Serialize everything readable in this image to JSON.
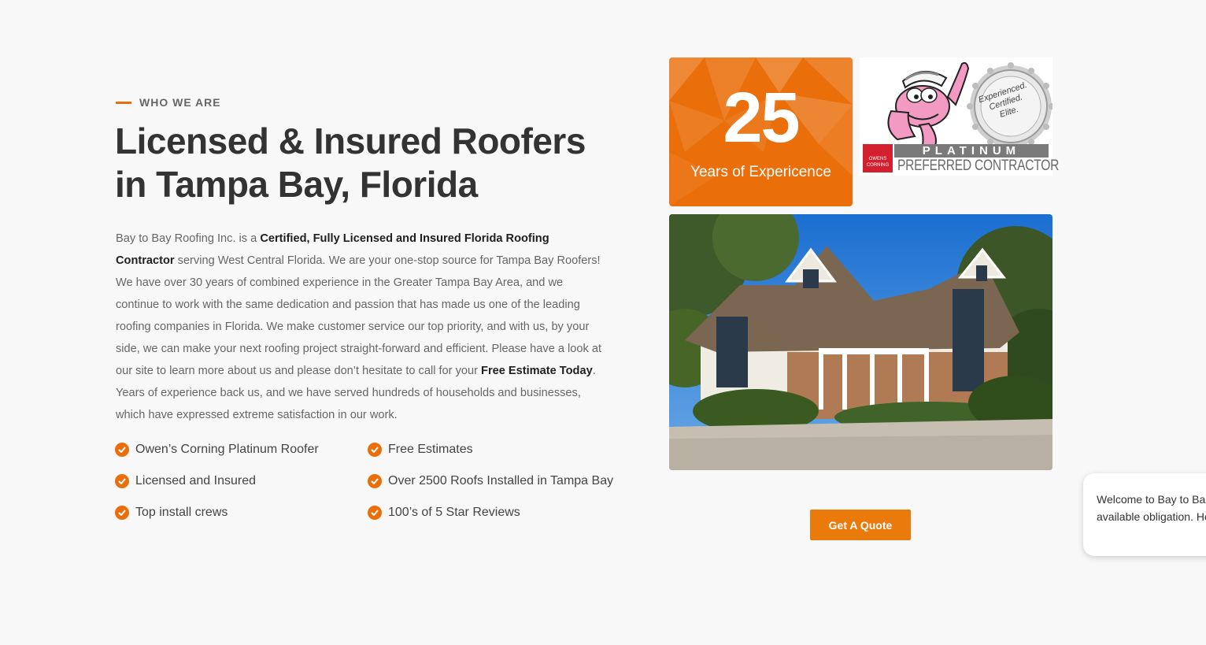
{
  "section": {
    "eyebrow": "WHO WE ARE",
    "heading_line1": "Licensed & Insured Roofers",
    "heading_line2": "in Tampa Bay, Florida"
  },
  "intro": {
    "p1": "Bay to Bay Roofing Inc. is a ",
    "b1": "Certified, Fully Licensed and Insured Florida Roofing Contractor",
    "p2": " serving West Central Florida. We are your one-stop source for Tampa Bay Roofers! We have over 30 years of combined experience in the Greater Tampa Bay Area, and we continue to work with the same dedication and passion that has made us one of the leading roofing companies in Florida. We make customer service our top priority, and with us, by your side, we can make your next roofing project straight-forward and efficient. Please have a look at our site to learn more about us and please don’t hesitate to call for your ",
    "b2": "Free Estimate Today",
    "p3": ". Years of experience back us, and we have served hundreds of households and businesses, which have expressed extreme satisfaction in our work."
  },
  "features": [
    {
      "label": "Owen’s Corning Platinum Roofer"
    },
    {
      "label": "Free Estimates"
    },
    {
      "label": "Licensed and Insured"
    },
    {
      "label": "Over 2500 Roofs Installed in Tampa Bay"
    },
    {
      "label": "Top install crews"
    },
    {
      "label": "100’s of 5 Star Reviews"
    }
  ],
  "experience": {
    "number": "25",
    "label": "Years of Expericence"
  },
  "badge": {
    "band": "PLATINUM",
    "subtitle": "PREFERRED CONTRACTOR",
    "brand": "OWENS CORNING",
    "seal_line1": "Experienced.",
    "seal_line2": "Certified.",
    "seal_line3": "Elite."
  },
  "cta": {
    "quote_label": "Get A Quote"
  },
  "chat": {
    "message": "Welcome to Bay to Ba real person is available obligation. How can we"
  },
  "colors": {
    "accent": "#ea6f0b",
    "heading": "#333333",
    "body": "#666666",
    "background": "#f8f8f8"
  }
}
